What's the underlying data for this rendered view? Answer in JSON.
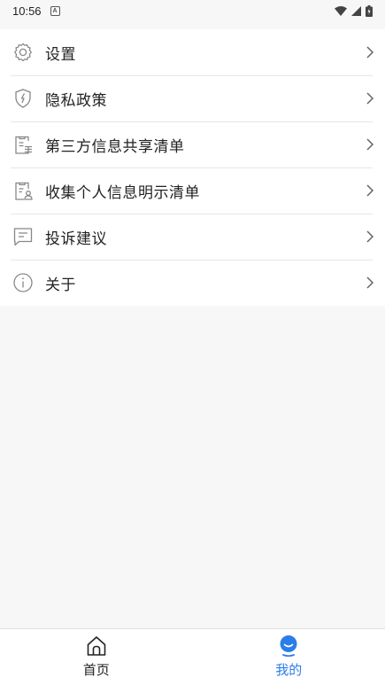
{
  "status_bar": {
    "time": "10:56",
    "notification_letter": "A"
  },
  "menu": {
    "items": [
      {
        "label": "设置",
        "icon": "gear-icon"
      },
      {
        "label": "隐私政策",
        "icon": "shield-icon"
      },
      {
        "label": "第三方信息共享清单",
        "icon": "clipboard-list-icon"
      },
      {
        "label": "收集个人信息明示清单",
        "icon": "clipboard-user-icon"
      },
      {
        "label": "投诉建议",
        "icon": "message-icon"
      },
      {
        "label": "关于",
        "icon": "info-icon"
      }
    ]
  },
  "tabbar": {
    "tabs": [
      {
        "label": "首页",
        "icon": "home-icon",
        "active": false
      },
      {
        "label": "我的",
        "icon": "user-icon",
        "active": true
      }
    ],
    "active_color": "#2b7de9"
  }
}
